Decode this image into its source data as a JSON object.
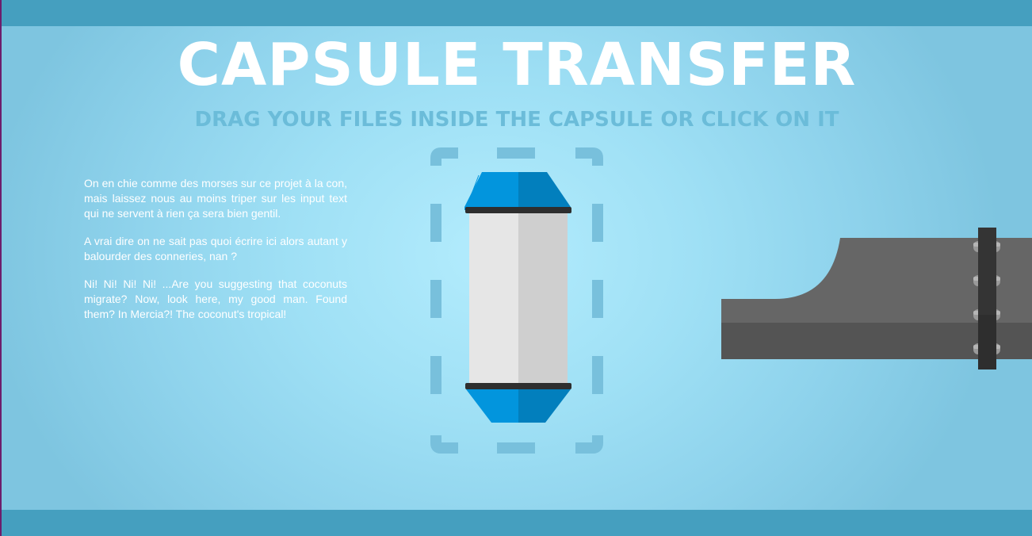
{
  "header": {
    "title": "CAPSULE TRANSFER",
    "subtitle": "DRAG YOUR FILES INSIDE THE CAPSULE OR CLICK ON IT"
  },
  "description": {
    "paragraphs": [
      "On en chie comme des morses sur ce projet à la con, mais laissez nous au moins triper sur les input text qui ne servent à rien ça sera bien gentil.",
      "A vrai dire on ne sait pas quoi écrire ici alors autant y balourder des conneries, nan ?",
      "Ni! Ni! Ni! Ni! ...Are you suggesting that coconuts migrate? Now, look here, my good man. Found them? In Mercia?! The coconut's tropical!"
    ]
  },
  "icons": {
    "capsule": "capsule-icon",
    "dropzone": "dashed-dropzone-frame",
    "pipe": "pneumatic-tube-pipe"
  },
  "colors": {
    "bar": "#459fbf",
    "subtitle": "#6bbcd9",
    "dash": "#78c0dc",
    "capsule_blue": "#0295dd",
    "capsule_blue_dark": "#027fbd",
    "capsule_body": "#e6e6e6",
    "capsule_body_shade": "#cfcfcf",
    "pipe": "#666666",
    "pipe_dark": "#545454",
    "flange": "#2e2e2e"
  }
}
